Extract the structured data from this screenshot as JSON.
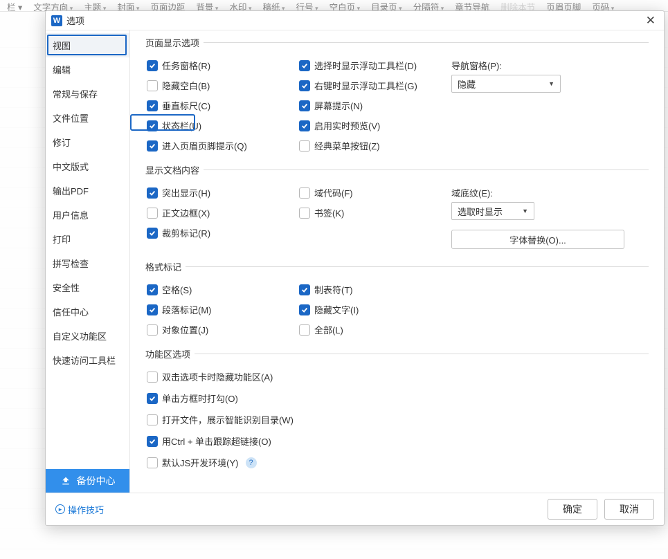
{
  "ribbon": {
    "items": [
      "栏 ▾",
      "文字方向",
      "主题",
      "封面",
      "页面边距",
      "背景",
      "水印",
      "稿纸",
      "行号",
      "空白页",
      "目录页",
      "分隔符",
      "章节导航",
      "删除本节",
      "页眉页脚",
      "页码"
    ]
  },
  "dialog": {
    "title": "选项",
    "close_icon_name": "close-icon"
  },
  "sidebar": {
    "items": [
      {
        "id": "view",
        "label": "视图",
        "selected": true
      },
      {
        "id": "edit",
        "label": "编辑"
      },
      {
        "id": "general",
        "label": "常规与保存"
      },
      {
        "id": "fileloc",
        "label": "文件位置"
      },
      {
        "id": "revision",
        "label": "修订"
      },
      {
        "id": "chinese",
        "label": "中文版式"
      },
      {
        "id": "outputpdf",
        "label": "输出PDF"
      },
      {
        "id": "userinfo",
        "label": "用户信息"
      },
      {
        "id": "print",
        "label": "打印"
      },
      {
        "id": "spell",
        "label": "拼写检查"
      },
      {
        "id": "security",
        "label": "安全性"
      },
      {
        "id": "trust",
        "label": "信任中心"
      },
      {
        "id": "customfn",
        "label": "自定义功能区"
      },
      {
        "id": "quick",
        "label": "快速访问工具栏"
      }
    ],
    "backup_label": "备份中心"
  },
  "groups": {
    "page_display": {
      "legend": "页面显示选项",
      "left": [
        {
          "checked": true,
          "label": "任务窗格(R)"
        },
        {
          "checked": false,
          "label": "隐藏空白(B)"
        },
        {
          "checked": true,
          "label": "垂直标尺(C)"
        },
        {
          "checked": true,
          "label": "状态栏(U)",
          "highlight": true
        },
        {
          "checked": true,
          "label": "进入页眉页脚提示(Q)"
        }
      ],
      "mid": [
        {
          "checked": true,
          "label": "选择时显示浮动工具栏(D)"
        },
        {
          "checked": true,
          "label": "右键时显示浮动工具栏(G)"
        },
        {
          "checked": true,
          "label": "屏幕提示(N)"
        },
        {
          "checked": true,
          "label": "启用实时预览(V)"
        },
        {
          "checked": false,
          "label": "经典菜单按钮(Z)"
        }
      ],
      "nav_label": "导航窗格(P):",
      "nav_select": "隐藏"
    },
    "doc_content": {
      "legend": "显示文档内容",
      "left": [
        {
          "checked": true,
          "label": "突出显示(H)"
        },
        {
          "checked": false,
          "label": "正文边框(X)"
        },
        {
          "checked": true,
          "label": "裁剪标记(R)"
        }
      ],
      "mid": [
        {
          "checked": false,
          "label": "域代码(F)"
        },
        {
          "checked": false,
          "label": "书签(K)"
        }
      ],
      "shading_label": "域底纹(E):",
      "shading_select": "选取时显示",
      "font_sub_btn": "字体替换(O)..."
    },
    "fmt_marks": {
      "legend": "格式标记",
      "left": [
        {
          "checked": true,
          "label": "空格(S)"
        },
        {
          "checked": true,
          "label": "段落标记(M)"
        },
        {
          "checked": false,
          "label": "对象位置(J)"
        }
      ],
      "mid": [
        {
          "checked": true,
          "label": "制表符(T)"
        },
        {
          "checked": true,
          "label": "隐藏文字(I)"
        },
        {
          "checked": false,
          "label": "全部(L)"
        }
      ]
    },
    "ribbon_opts": {
      "legend": "功能区选项",
      "items": [
        {
          "checked": false,
          "label": "双击选项卡时隐藏功能区(A)"
        },
        {
          "checked": true,
          "label": "单击方框时打勾(O)"
        },
        {
          "checked": false,
          "label": "打开文件，展示智能识别目录(W)"
        },
        {
          "checked": true,
          "label": "用Ctrl + 单击跟踪超链接(O)"
        },
        {
          "checked": false,
          "label": "默认JS开发环境(Y)",
          "help": true
        }
      ]
    }
  },
  "footer": {
    "tips_label": "操作技巧",
    "ok_label": "确定",
    "cancel_label": "取消"
  }
}
